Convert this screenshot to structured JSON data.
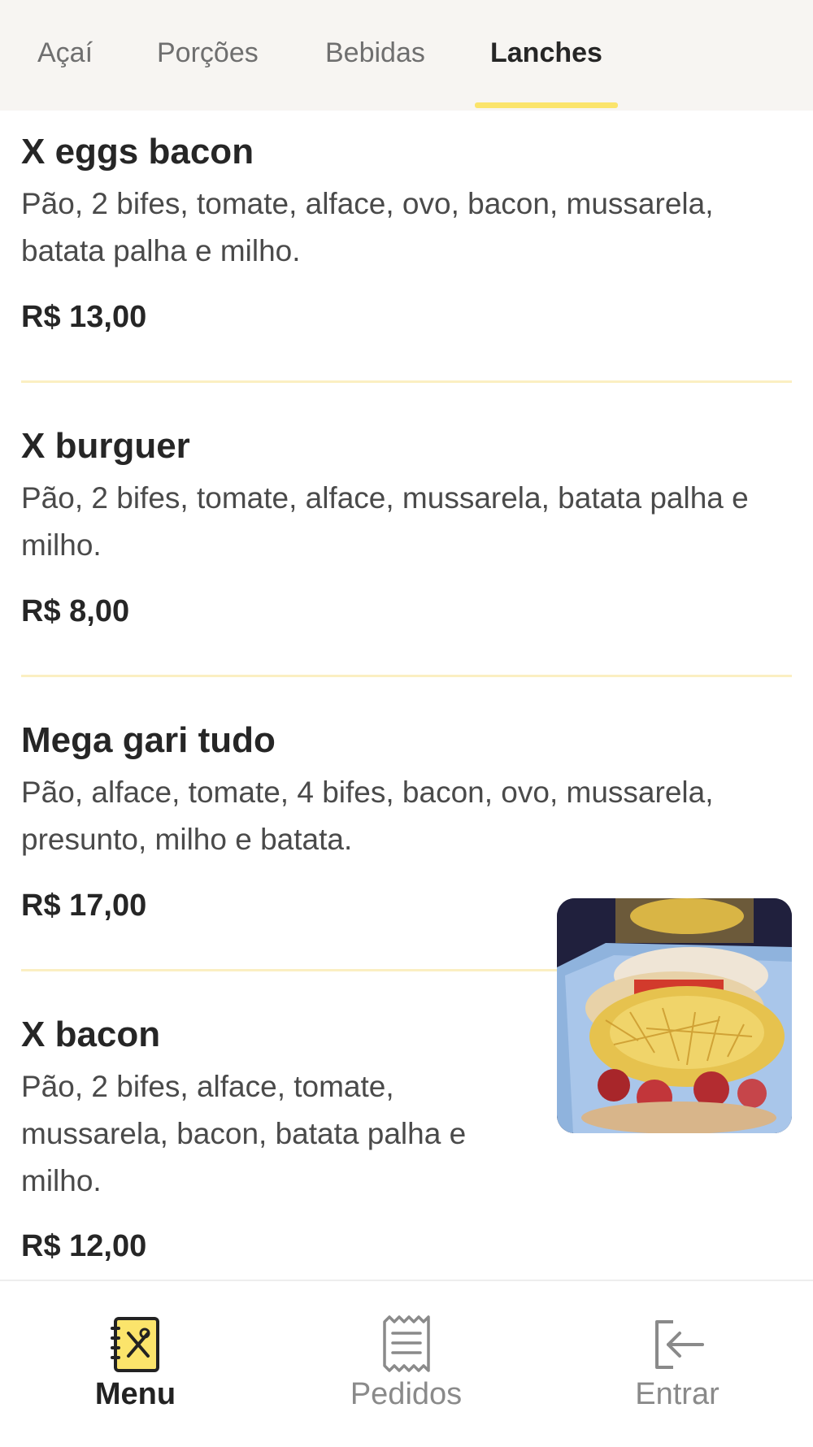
{
  "tabs": [
    {
      "label": "Açaí"
    },
    {
      "label": "Porções"
    },
    {
      "label": "Bebidas"
    },
    {
      "label": "Lanches",
      "active": true
    }
  ],
  "items": [
    {
      "name": "X eggs bacon",
      "description": "Pão, 2 bifes, tomate, alface, ovo, bacon, mussarela, batata palha e milho.",
      "price": "R$ 13,00"
    },
    {
      "name": "X burguer",
      "description": "Pão, 2 bifes, tomate, alface, mussarela, batata palha e milho.",
      "price": "R$ 8,00"
    },
    {
      "name": "Mega gari tudo",
      "description": "Pão, alface, tomate, 4 bifes, bacon, ovo, mussarela, presunto, milho e batata.",
      "price": "R$ 17,00"
    },
    {
      "name": "X bacon",
      "description": "Pão, 2 bifes, alface, tomate, mussarela, bacon, batata palha e milho.",
      "price": "R$ 12,00",
      "has_photo": true
    }
  ],
  "bottom_nav": [
    {
      "label": "Menu",
      "icon": "menu-book-icon",
      "active": true
    },
    {
      "label": "Pedidos",
      "icon": "receipt-icon"
    },
    {
      "label": "Entrar",
      "icon": "login-icon"
    }
  ],
  "colors": {
    "accent": "#fbe46b",
    "divider": "#fbefc2",
    "tabbar_bg": "#f7f5f2",
    "text_dark": "#262626",
    "text_muted": "#8a8a8a"
  }
}
